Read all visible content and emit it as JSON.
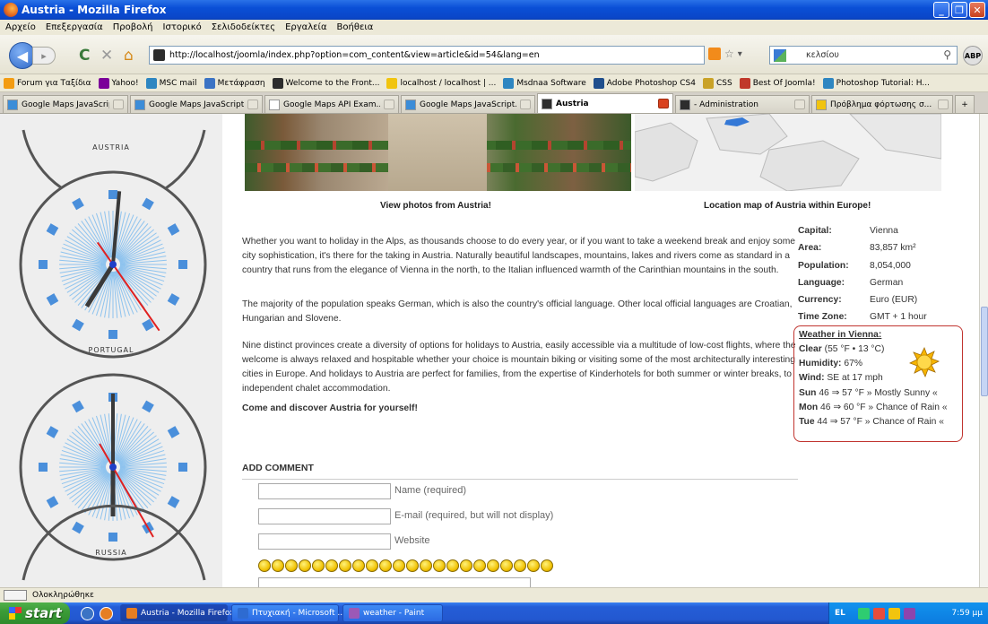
{
  "window": {
    "title": "Austria - Mozilla Firefox",
    "min": "_",
    "max": "❐",
    "close": "✕"
  },
  "menu": [
    "Αρχείο",
    "Επεξεργασία",
    "Προβολή",
    "Ιστορικό",
    "Σελιδοδείκτες",
    "Εργαλεία",
    "Βοήθεια"
  ],
  "nav": {
    "back": "◀",
    "forward": "▸",
    "reload": "C",
    "stop": "✕",
    "home": "⌂",
    "url": "http://localhost/joomla/index.php?option=com_content&view=article&id=54&lang=en",
    "search_value": "κελσίου",
    "abp": "ABP",
    "star": "☆",
    "drop": "▾"
  },
  "bookmarks": [
    {
      "label": "Forum για Ταξίδια",
      "color": "#f39c12"
    },
    {
      "label": "Yahoo!",
      "color": "#7b0099"
    },
    {
      "label": "MSC mail",
      "color": "#2e86c1"
    },
    {
      "label": "Μετάφραση",
      "color": "#3b73c4"
    },
    {
      "label": "Welcome to the Front...",
      "color": "#2d2d2d"
    },
    {
      "label": "localhost / localhost | ...",
      "color": "#f1c40f"
    },
    {
      "label": "Msdnaa Software",
      "color": "#2e86c1"
    },
    {
      "label": "Adobe Photoshop CS4",
      "color": "#1f4e8c"
    },
    {
      "label": "CSS",
      "color": "#c9a227"
    },
    {
      "label": "Best Of Joomla!",
      "color": "#c0392b"
    },
    {
      "label": "Photoshop Tutorial: H...",
      "color": "#2e86c1"
    }
  ],
  "tabs": [
    {
      "label": "Google Maps JavaScript...",
      "active": false,
      "color": "#3c8dd8"
    },
    {
      "label": "Google Maps JavaScript...",
      "active": false,
      "color": "#3c8dd8"
    },
    {
      "label": "Google Maps API Exam...",
      "active": false,
      "color": "#ffffff"
    },
    {
      "label": "Google Maps JavaScript...",
      "active": false,
      "color": "#3c8dd8"
    },
    {
      "label": "Austria",
      "active": true,
      "color": "#2d2d2d"
    },
    {
      "label": "- Administration",
      "active": false,
      "color": "#2d2d2d"
    },
    {
      "label": "Πρόβλημα φόρτωσης σ...",
      "active": false,
      "color": "#f1c40f"
    }
  ],
  "tabs_new": "+",
  "sidebar": {
    "clocks": [
      {
        "label": "AUSTRIA"
      },
      {
        "label": "PORTUGAL"
      },
      {
        "label": "RUSSIA"
      }
    ]
  },
  "article": {
    "caption_photos": "View photos from Austria!",
    "caption_map": "Location map of Austria within Europe!",
    "paragraphs": [
      "Whether you want to holiday in the Alps, as thousands choose to do every year, or if you want to take a weekend break and enjoy some city sophistication, it's there for the taking in Austria. Naturally beautiful landscapes, mountains, lakes and rivers come as standard in a country that runs from the elegance of Vienna in the north, to the Italian influenced warmth of the Carinthian mountains in the south.",
      "The majority of the population speaks German, which is also the country's official language. Other local official languages are Croatian, Hungarian and Slovene.",
      "Nine distinct provinces create a diversity of options for holidays to Austria, easily accessible via a multitude of low-cost flights, where the welcome is always relaxed and hospitable whether your choice is mountain biking or visiting some of the most architecturally interesting cities in Europe. And holidays to Austria are perfect for families, from the expertise of Kinderhotels for both summer or winter breaks, to independent chalet accommodation."
    ],
    "closing": "Come and discover Austria for yourself!"
  },
  "facts": [
    {
      "key": "Capital:",
      "value": "Vienna"
    },
    {
      "key": "Area:",
      "value": "83,857 km²"
    },
    {
      "key": "Population:",
      "value": "8,054,000"
    },
    {
      "key": "Language:",
      "value": "German"
    },
    {
      "key": "Currency:",
      "value": "Euro (EUR)"
    },
    {
      "key": "Time Zone:",
      "value": "GMT + 1 hour"
    }
  ],
  "weather": {
    "title": "Weather in Vienna:",
    "current_cond": "Clear",
    "current_temp": "(55 °F • 13 °C)",
    "humidity_label": "Humidity:",
    "humidity": "67%",
    "wind_label": "Wind:",
    "wind": "SE at 17 mph",
    "forecast": [
      {
        "day": "Sun",
        "range": "46 ⇒ 57 °F »",
        "cond": "Mostly Sunny «"
      },
      {
        "day": "Mon",
        "range": "46 ⇒ 60 °F »",
        "cond": "Chance of Rain «"
      },
      {
        "day": "Tue",
        "range": "44 ⇒ 57 °F »",
        "cond": "Chance of Rain «"
      }
    ]
  },
  "comment": {
    "heading": "ADD COMMENT",
    "name_label": "Name (required)",
    "email_label": "E-mail (required, but will not display)",
    "website_label": "Website",
    "smiley_count": 22
  },
  "status": {
    "text": "Ολοκληρώθηκε"
  },
  "taskbar": {
    "start": "start",
    "tasks": [
      {
        "label": "Austria - Mozilla Firefox",
        "active": true,
        "color": "#e67e22"
      },
      {
        "label": "Πτυχιακή - Microsoft ...",
        "active": false,
        "color": "#2e6bd1"
      },
      {
        "label": "weather - Paint",
        "active": false,
        "color": "#9b59b6"
      }
    ],
    "lang": "EL",
    "clock": "7:59 μμ"
  }
}
